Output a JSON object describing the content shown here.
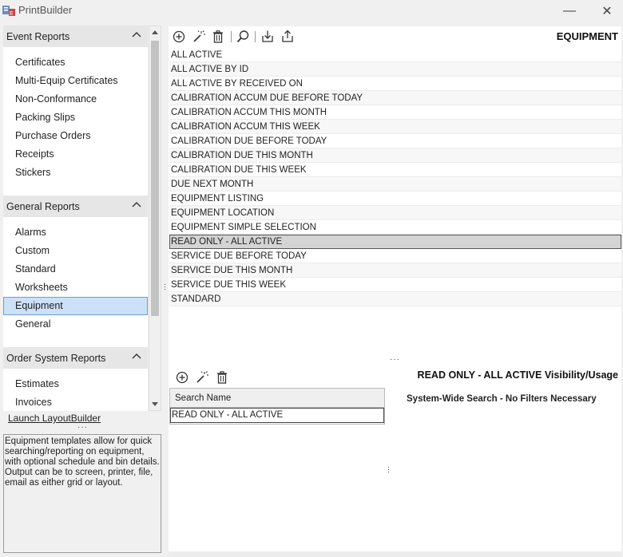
{
  "app": {
    "title": "PrintBuilder"
  },
  "window": {
    "minimize_glyph": "—",
    "close_glyph": "✕"
  },
  "sidebar": {
    "sections": [
      {
        "header": "Event Reports",
        "items": [
          "Certificates",
          "Multi-Equip Certificates",
          "Non-Conformance",
          "Packing Slips",
          "Purchase Orders",
          "Receipts",
          "Stickers"
        ]
      },
      {
        "header": "General Reports",
        "items": [
          "Alarms",
          "Custom",
          "Standard",
          "Worksheets",
          "Equipment",
          "General"
        ]
      },
      {
        "header": "Order System Reports",
        "items": [
          "Estimates",
          "Invoices"
        ]
      }
    ],
    "selected_item": "Equipment",
    "launch_label": "Launch LayoutBuilder",
    "description": "Equipment templates allow for quick searching/reporting on equipment, with optional schedule and bin details. Output can be to screen, printer, file, email as either grid or layout."
  },
  "main": {
    "title": "EQUIPMENT",
    "toolbar_icons": [
      "add-icon",
      "magic-wand-icon",
      "trash-icon",
      "search-icon",
      "import-icon",
      "export-icon"
    ],
    "templates": [
      "ALL ACTIVE",
      "ALL ACTIVE BY ID",
      "ALL ACTIVE BY RECEIVED ON",
      "CALIBRATION ACCUM DUE BEFORE TODAY",
      "CALIBRATION ACCUM THIS MONTH",
      "CALIBRATION ACCUM THIS WEEK",
      "CALIBRATION DUE BEFORE TODAY",
      "CALIBRATION DUE THIS MONTH",
      "CALIBRATION DUE THIS WEEK",
      "DUE NEXT MONTH",
      "EQUIPMENT LISTING",
      "EQUIPMENT LOCATION",
      "EQUIPMENT SIMPLE SELECTION",
      "READ ONLY - ALL ACTIVE",
      "SERVICE DUE BEFORE TODAY",
      "SERVICE DUE THIS MONTH",
      "SERVICE DUE THIS WEEK",
      "STANDARD"
    ],
    "selected_template": "READ ONLY - ALL ACTIVE"
  },
  "visibility": {
    "title": "READ ONLY - ALL ACTIVE Visibility/Usage",
    "note": "System-Wide Search - No Filters Necessary",
    "grid_header": "Search Name",
    "grid_rows": [
      "READ ONLY - ALL ACTIVE"
    ]
  },
  "colors": {
    "selected_sidebar_bg": "#cce0f7",
    "selected_row_bg": "#d4d4d4",
    "header_bg": "#e6e6e6"
  }
}
